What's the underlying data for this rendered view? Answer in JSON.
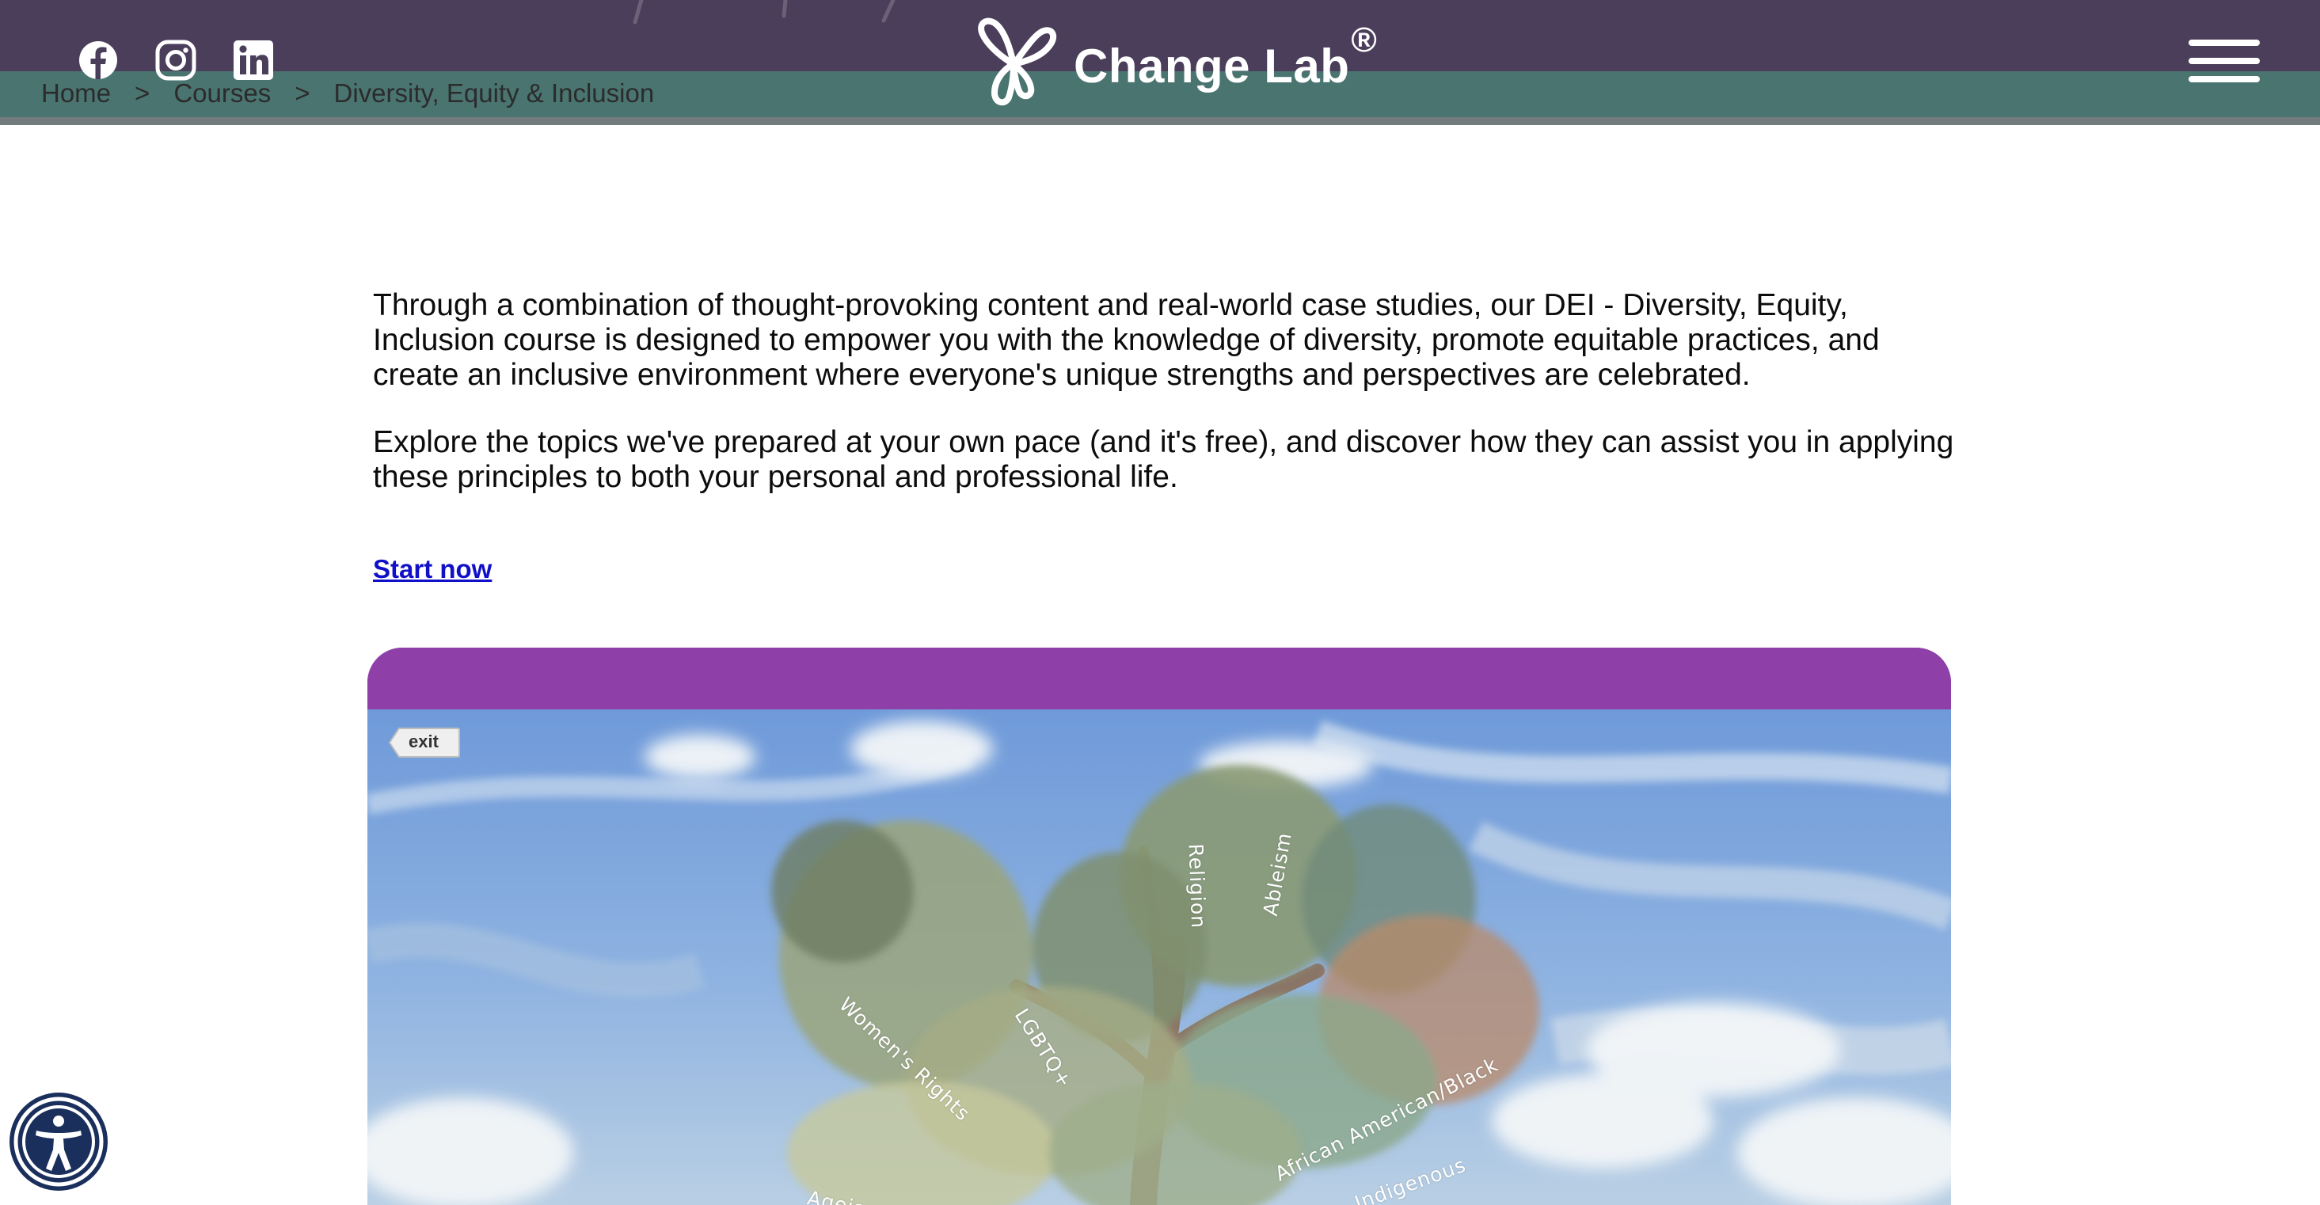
{
  "header": {
    "brand_name": "Change Lab",
    "brand_mark": "®",
    "social": [
      {
        "name": "facebook-icon"
      },
      {
        "name": "instagram-icon"
      },
      {
        "name": "linkedin-icon"
      }
    ],
    "menu_icon": "hamburger-menu-icon",
    "colors": {
      "top": "#4b3e5b",
      "band": "#4a7470"
    }
  },
  "breadcrumb": {
    "items": [
      "Home",
      "Courses",
      "Diversity, Equity & Inclusion"
    ],
    "separator": ">"
  },
  "intro": {
    "paragraph_1": "Through a combination of thought-provoking content and real-world case studies, our DEI - Diversity, Equity, Inclusion course is designed to empower you with the knowledge of diversity, promote equitable practices, and create an inclusive environment where everyone's unique strengths and perspectives are celebrated.",
    "paragraph_2": "Explore the topics we've prepared at your own pace (and it's free), and discover how they can assist you in applying these principles to both your personal and professional life.",
    "start_link": "Start now"
  },
  "course": {
    "exit_label": "exit",
    "frame_color": "#8e3fa8",
    "tree_labels": [
      "Religion",
      "Ableism",
      "Women's Rights",
      "LGBTQ+",
      "African American/Black",
      "Indigenous",
      "Ageism"
    ]
  },
  "accessibility": {
    "icon": "accessibility-icon"
  }
}
